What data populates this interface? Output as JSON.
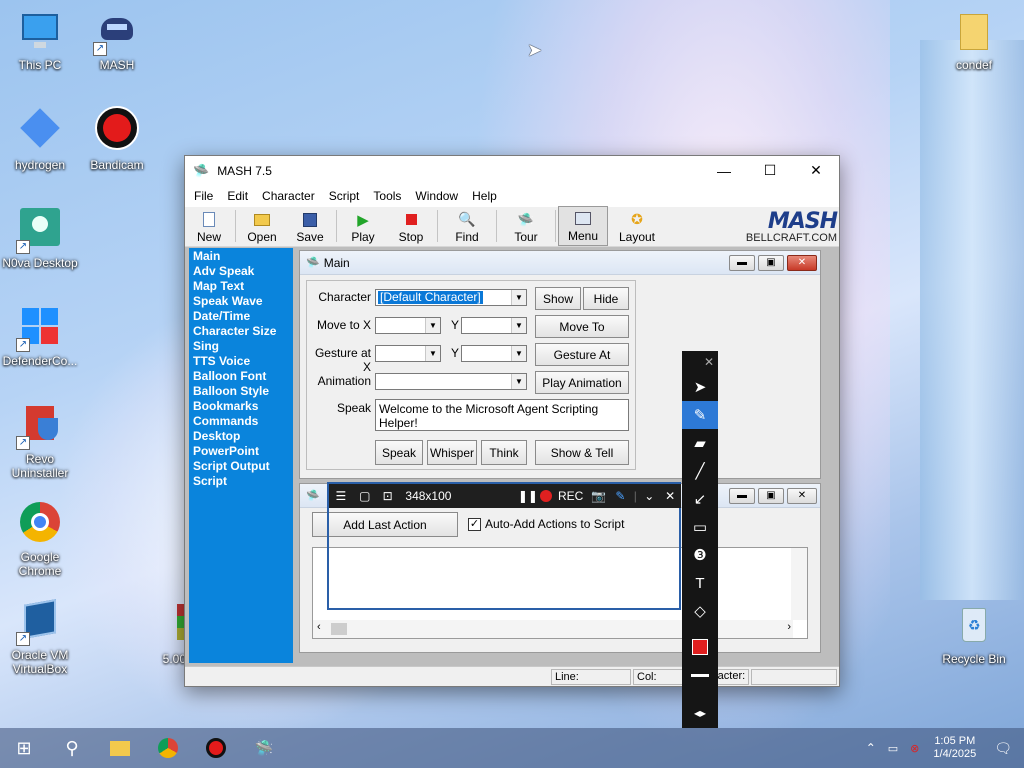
{
  "desktop": {
    "icons": [
      {
        "label": "This PC"
      },
      {
        "label": "MASH"
      },
      {
        "label": "hydrogen"
      },
      {
        "label": "Bandicam"
      },
      {
        "label": "N0va Desktop"
      },
      {
        "label": "DefenderCo..."
      },
      {
        "label": "Revo Uninstaller"
      },
      {
        "label": "Google Chrome"
      },
      {
        "label": "Oracle VM VirtualBox"
      },
      {
        "label": "condef"
      },
      {
        "label": "Recycle Bin"
      }
    ],
    "partial_label": "5.00"
  },
  "window": {
    "title": "MASH 7.5",
    "controls": {
      "minimize": "—",
      "maximize": "☐",
      "close": "✕"
    },
    "menu": [
      "File",
      "Edit",
      "Character",
      "Script",
      "Tools",
      "Window",
      "Help"
    ],
    "toolbar": {
      "new": "New",
      "open": "Open",
      "save": "Save",
      "play": "Play",
      "stop": "Stop",
      "find": "Find",
      "tour": "Tour",
      "menu": "Menu",
      "layout": "Layout"
    },
    "logo": {
      "big": "MASH",
      "small": "BELLCRAFT.COM"
    },
    "sidebar": [
      "Main",
      "Adv Speak",
      "Map Text",
      "Speak Wave",
      "Date/Time",
      "Character Size",
      "Sing",
      "TTS Voice",
      "Balloon Font",
      "Balloon Style",
      "Bookmarks",
      "Commands",
      "Desktop",
      "PowerPoint",
      "Script Output",
      "Script"
    ],
    "main_child": {
      "title": "Main",
      "labels": {
        "character": "Character",
        "move_to_x": "Move to X",
        "y1": "Y",
        "gesture_at_x": "Gesture at X",
        "y2": "Y",
        "animation": "Animation",
        "speak": "Speak"
      },
      "character_value": "[Default Character]",
      "speak_text": "Welcome to the Microsoft Agent Scripting Helper!",
      "buttons": {
        "show": "Show",
        "hide": "Hide",
        "move_to": "Move To",
        "gesture_at": "Gesture At",
        "play_animation": "Play Animation",
        "speak": "Speak",
        "whisper": "Whisper",
        "think": "Think",
        "show_tell": "Show & Tell"
      }
    },
    "script_child": {
      "add_last_action": "Add Last Action",
      "auto_add": "Auto-Add Actions to Script",
      "auto_add_checked": true
    },
    "status": {
      "line": "Line:",
      "col": "Col:",
      "character": "racter:"
    }
  },
  "bandicam": {
    "size": "348x100",
    "rec": "REC"
  },
  "taskbar": {
    "clock_time": "1:05 PM",
    "clock_date": "1/4/2025"
  },
  "colors": {
    "sidebar": "#0a84dc",
    "selection": "#0a78d7",
    "rec_red": "#e02020",
    "pen_active": "#2d79d6"
  }
}
